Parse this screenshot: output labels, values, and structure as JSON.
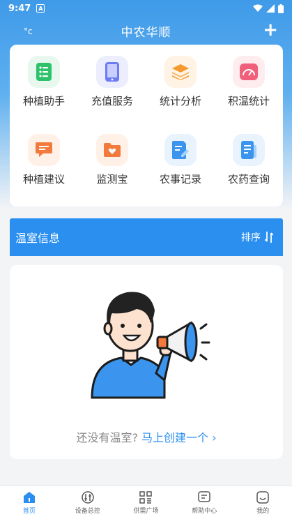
{
  "status_bar": {
    "time": "9:47",
    "notif_letter": "A"
  },
  "app_bar": {
    "temperature": "°c",
    "title": "中农华顺",
    "add_label": "+"
  },
  "grid": [
    {
      "label": "种植助手",
      "icon": "list-icon",
      "bg": "#e8f8ee",
      "fg": "#2ec26b"
    },
    {
      "label": "充值服务",
      "icon": "phone-icon",
      "bg": "#eceefe",
      "fg": "#6c7cf5"
    },
    {
      "label": "统计分析",
      "icon": "layers-icon",
      "bg": "#fff3e5",
      "fg": "#f59a2e"
    },
    {
      "label": "积温统计",
      "icon": "gauge-icon",
      "bg": "#feecef",
      "fg": "#f0607a"
    },
    {
      "label": "种植建议",
      "icon": "comment-icon",
      "bg": "#fff1e8",
      "fg": "#f27a3c"
    },
    {
      "label": "监测宝",
      "icon": "folder-heart-icon",
      "bg": "#fff1e8",
      "fg": "#f27a3c"
    },
    {
      "label": "农事记录",
      "icon": "edit-doc-icon",
      "bg": "#e8f3fe",
      "fg": "#3b95ef"
    },
    {
      "label": "农药查询",
      "icon": "doc-icon",
      "bg": "#e8f3fe",
      "fg": "#3b95ef"
    }
  ],
  "section": {
    "title": "温室信息",
    "sort_label": "排序"
  },
  "empty": {
    "text": "还没有温室?",
    "link": "马上创建一个",
    "chevron": "›"
  },
  "nav": [
    {
      "label": "首页",
      "icon": "home-icon",
      "active": true
    },
    {
      "label": "设备总控",
      "icon": "sliders-icon",
      "active": false
    },
    {
      "label": "供需广场",
      "icon": "grid-icon",
      "active": false
    },
    {
      "label": "帮助中心",
      "icon": "chat-icon",
      "active": false
    },
    {
      "label": "我的",
      "icon": "smile-icon",
      "active": false
    }
  ],
  "colors": {
    "primary": "#2b8ff0",
    "background": "#f3f4f6"
  }
}
